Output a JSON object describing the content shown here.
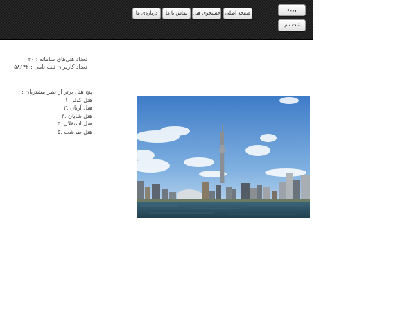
{
  "header": {
    "nav": [
      {
        "id": "home",
        "label": "صفحه اصلی"
      },
      {
        "id": "search",
        "label": "جستجوی هتل"
      },
      {
        "id": "contact",
        "label": "تماس با ما"
      },
      {
        "id": "about",
        "label": "درباره‌ی ما"
      }
    ],
    "login_label": "ورود",
    "register_label": "ثبت نام"
  },
  "stats": {
    "hotels_line": "تعداد هتل‌های سامانه : ۲۰",
    "users_line": "تعداد کاربران ثبت نامی : ۵۸۶۴۲"
  },
  "top_hotels": {
    "title": "پنج هتل برتر از نظر مشتریان :",
    "items": [
      "هتل کوثر .۱",
      "هتل آریان .۲",
      "هتل شایان .۳",
      "هتل استقلال .۴",
      "هتل طرشت .۵"
    ]
  },
  "colors": {
    "header_bg": "#1b1b1b",
    "sky": "#4f86c6",
    "water": "#2c4f63"
  }
}
